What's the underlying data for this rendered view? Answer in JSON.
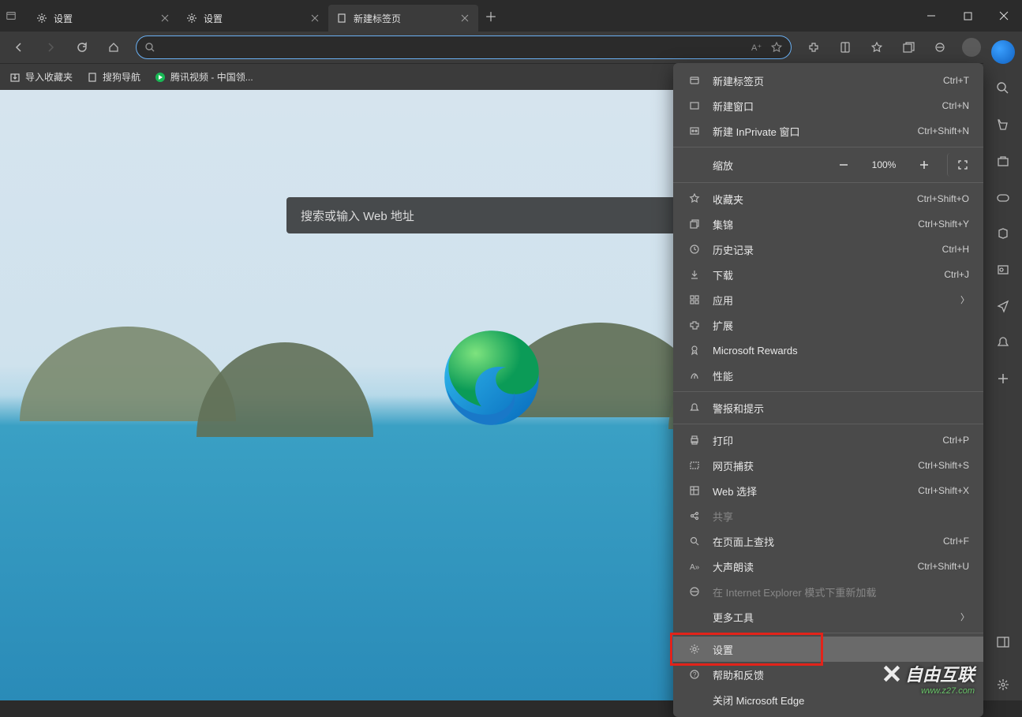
{
  "tabs": [
    {
      "icon": "gear",
      "label": "设置"
    },
    {
      "icon": "gear",
      "label": "设置"
    },
    {
      "icon": "page",
      "label": "新建标签页",
      "active": true
    }
  ],
  "bookmarks": {
    "import": "导入收藏夹",
    "items": [
      {
        "icon": "page",
        "label": "搜狗导航"
      },
      {
        "icon": "video",
        "label": "腾讯视频 - 中国领..."
      }
    ]
  },
  "search_placeholder": "搜索或输入 Web 地址",
  "zoom": {
    "label": "缩放",
    "value": "100%"
  },
  "menu": [
    {
      "type": "item",
      "icon": "tab",
      "label": "新建标签页",
      "shortcut": "Ctrl+T"
    },
    {
      "type": "item",
      "icon": "window",
      "label": "新建窗口",
      "shortcut": "Ctrl+N"
    },
    {
      "type": "item",
      "icon": "inprivate",
      "label": "新建 InPrivate 窗口",
      "shortcut": "Ctrl+Shift+N"
    },
    {
      "type": "sep"
    },
    {
      "type": "zoom"
    },
    {
      "type": "sep"
    },
    {
      "type": "item",
      "icon": "star",
      "label": "收藏夹",
      "shortcut": "Ctrl+Shift+O"
    },
    {
      "type": "item",
      "icon": "collections",
      "label": "集锦",
      "shortcut": "Ctrl+Shift+Y"
    },
    {
      "type": "item",
      "icon": "history",
      "label": "历史记录",
      "shortcut": "Ctrl+H"
    },
    {
      "type": "item",
      "icon": "download",
      "label": "下载",
      "shortcut": "Ctrl+J"
    },
    {
      "type": "item",
      "icon": "apps",
      "label": "应用",
      "sub": true
    },
    {
      "type": "item",
      "icon": "extension",
      "label": "扩展"
    },
    {
      "type": "item",
      "icon": "rewards",
      "label": "Microsoft Rewards"
    },
    {
      "type": "item",
      "icon": "performance",
      "label": "性能"
    },
    {
      "type": "sep"
    },
    {
      "type": "item",
      "icon": "bell",
      "label": "警报和提示"
    },
    {
      "type": "sep"
    },
    {
      "type": "item",
      "icon": "print",
      "label": "打印",
      "shortcut": "Ctrl+P"
    },
    {
      "type": "item",
      "icon": "capture",
      "label": "网页捕获",
      "shortcut": "Ctrl+Shift+S"
    },
    {
      "type": "item",
      "icon": "webselect",
      "label": "Web 选择",
      "shortcut": "Ctrl+Shift+X"
    },
    {
      "type": "item",
      "icon": "share",
      "label": "共享",
      "disabled": true
    },
    {
      "type": "item",
      "icon": "find",
      "label": "在页面上查找",
      "shortcut": "Ctrl+F"
    },
    {
      "type": "item",
      "icon": "readaloud",
      "label": "大声朗读",
      "shortcut": "Ctrl+Shift+U"
    },
    {
      "type": "item",
      "icon": "ie",
      "label": "在 Internet Explorer 模式下重新加载",
      "disabled": true
    },
    {
      "type": "item",
      "icon": "",
      "label": "更多工具",
      "sub": true
    },
    {
      "type": "sep"
    },
    {
      "type": "item",
      "icon": "gear",
      "label": "设置",
      "highlight": true
    },
    {
      "type": "item",
      "icon": "help",
      "label": "帮助和反馈",
      "sub": true
    },
    {
      "type": "item",
      "icon": "",
      "label": "关闭 Microsoft Edge"
    }
  ],
  "watermark": {
    "main": "自由互联",
    "sub": "www.z27.com"
  }
}
